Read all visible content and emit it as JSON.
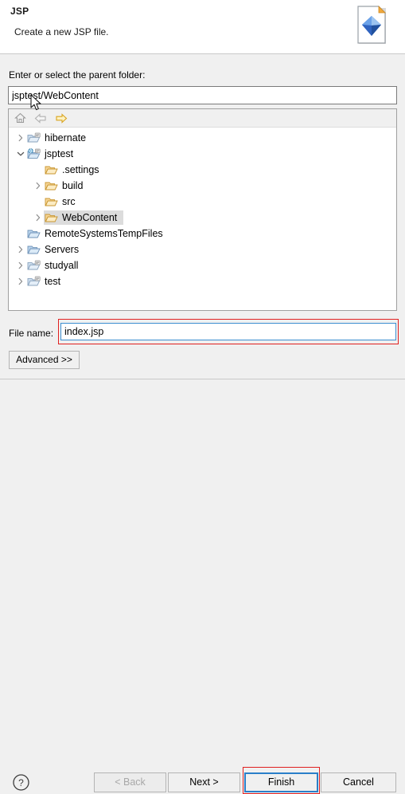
{
  "header": {
    "title": "JSP",
    "subtitle": "Create a new JSP file.",
    "icon": "jsp-file-icon"
  },
  "parent_folder": {
    "label": "Enter or select the parent folder:",
    "value": "jsptest/WebContent",
    "placeholder": ""
  },
  "tree_toolbar": {
    "home": "home-icon",
    "back": "back-arrow-icon",
    "forward": "forward-arrow-icon"
  },
  "tree": {
    "items": [
      {
        "label": "hibernate",
        "indent": 0,
        "twisty": "collapsed",
        "icon": "project-folder-icon",
        "selected": false
      },
      {
        "label": "jsptest",
        "indent": 0,
        "twisty": "expanded",
        "icon": "web-project-icon",
        "selected": false
      },
      {
        "label": ".settings",
        "indent": 1,
        "twisty": "none",
        "icon": "folder-icon",
        "selected": false
      },
      {
        "label": "build",
        "indent": 1,
        "twisty": "collapsed",
        "icon": "folder-icon",
        "selected": false
      },
      {
        "label": "src",
        "indent": 1,
        "twisty": "none",
        "icon": "folder-icon",
        "selected": false
      },
      {
        "label": "WebContent",
        "indent": 1,
        "twisty": "collapsed",
        "icon": "folder-icon",
        "selected": true
      },
      {
        "label": "RemoteSystemsTempFiles",
        "indent": 0,
        "twisty": "none",
        "icon": "blue-folder-icon",
        "selected": false
      },
      {
        "label": "Servers",
        "indent": 0,
        "twisty": "collapsed",
        "icon": "blue-folder-icon",
        "selected": false
      },
      {
        "label": "studyall",
        "indent": 0,
        "twisty": "collapsed",
        "icon": "project-folder-icon",
        "selected": false
      },
      {
        "label": "test",
        "indent": 0,
        "twisty": "collapsed",
        "icon": "project-folder-icon",
        "selected": false
      }
    ]
  },
  "file_name": {
    "label": "File name:",
    "value": "index.jsp",
    "placeholder": ""
  },
  "advanced": {
    "label": "Advanced >>"
  },
  "buttons": {
    "help": "help-icon",
    "back": "< Back",
    "next": "Next >",
    "finish": "Finish",
    "cancel": "Cancel"
  },
  "colors": {
    "dialog_background": "#f0f0f0",
    "field_background": "#ffffff",
    "focus_border": "#2a7fc9",
    "annotation": "#e02020",
    "selection": "#dcdcdc",
    "folder": "#f5c66a"
  }
}
